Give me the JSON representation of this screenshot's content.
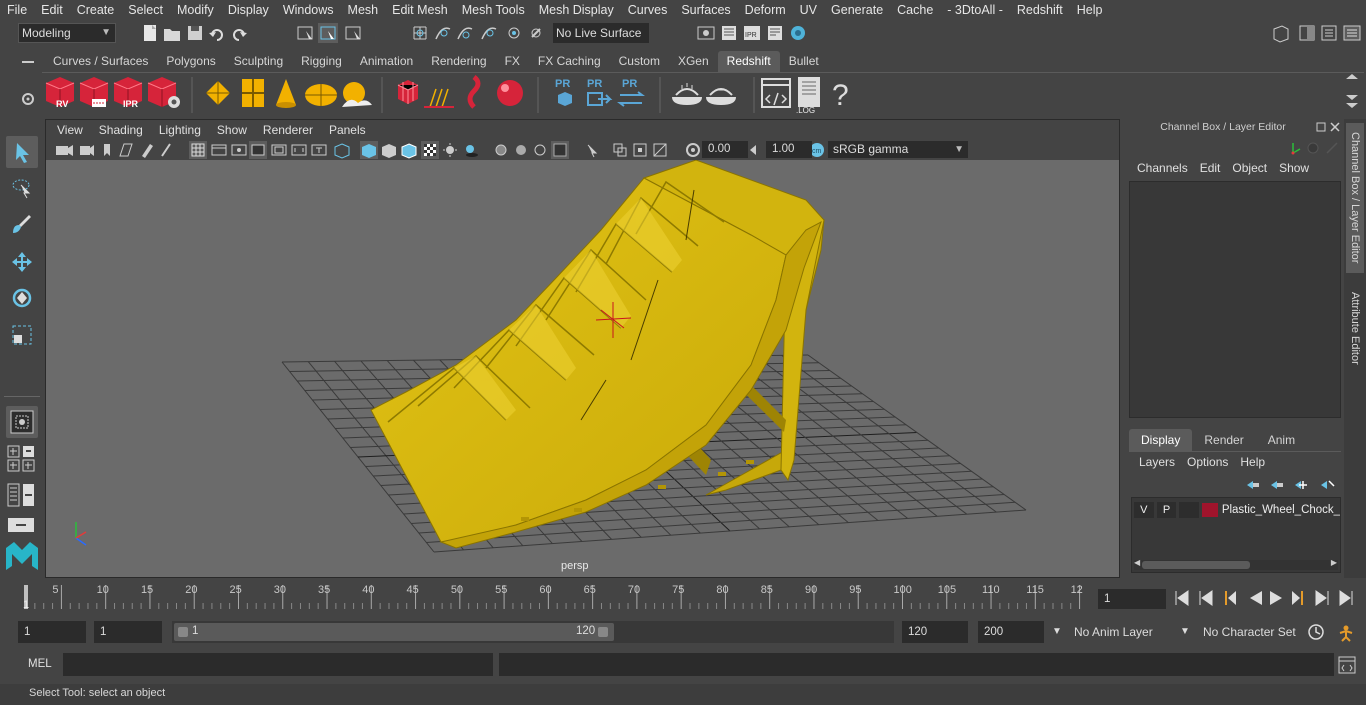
{
  "menubar": {
    "items": [
      "File",
      "Edit",
      "Create",
      "Select",
      "Modify",
      "Display",
      "Windows",
      "Mesh",
      "Edit Mesh",
      "Mesh Tools",
      "Mesh Display",
      "Curves",
      "Surfaces",
      "Deform",
      "UV",
      "Generate",
      "Cache",
      "- 3DtoAll -",
      "Redshift",
      "Help"
    ]
  },
  "statusline": {
    "mode": "Modeling",
    "live_surface": "No Live Surface"
  },
  "shelf": {
    "tabs": [
      "Curves / Surfaces",
      "Polygons",
      "Sculpting",
      "Rigging",
      "Animation",
      "Rendering",
      "FX",
      "FX Caching",
      "Custom",
      "XGen",
      "Redshift",
      "Bullet"
    ],
    "active_tab": "Redshift",
    "icon_labels": {
      "rv": "RV",
      "ipr": "IPR",
      "pr1": "PR",
      "pr2": "PR",
      "pr3": "PR",
      "log": ".LOG",
      "help": "?"
    }
  },
  "viewport": {
    "menu": [
      "View",
      "Shading",
      "Lighting",
      "Show",
      "Renderer",
      "Panels"
    ],
    "exposure": "0.00",
    "gamma": "1.00",
    "color_space": "sRGB gamma",
    "camera_label": "persp"
  },
  "channel_box": {
    "title": "Channel Box / Layer Editor",
    "menu": [
      "Channels",
      "Edit",
      "Object",
      "Show"
    ],
    "layer_tabs": [
      "Display",
      "Render",
      "Anim"
    ],
    "layer_menu": [
      "Layers",
      "Options",
      "Help"
    ],
    "layer": {
      "v": "V",
      "p": "P",
      "name": "Plastic_Wheel_Chock_Y"
    },
    "side_tabs": [
      "Channel Box / Layer Editor",
      "Attribute Editor"
    ]
  },
  "timeline": {
    "ticks": [
      "5",
      "10",
      "15",
      "20",
      "25",
      "30",
      "35",
      "40",
      "45",
      "50",
      "55",
      "60",
      "65",
      "70",
      "75",
      "80",
      "85",
      "90",
      "95",
      "100",
      "105",
      "110",
      "115",
      "12"
    ],
    "start_marker": "1",
    "current_frame": "1"
  },
  "range": {
    "start": "1",
    "playback_start": "1",
    "slider_start": "1",
    "slider_end": "120",
    "playback_end": "120",
    "end": "200",
    "anim_layer": "No Anim Layer",
    "character_set": "No Character Set"
  },
  "command": {
    "label": "MEL"
  },
  "help": {
    "text": "Select Tool: select an object"
  },
  "colors": {
    "model_yellow": "#d7b90b",
    "accent_blue": "#5aa6d6",
    "redshift_red": "#d6243a",
    "layer_color": "#a0142c"
  }
}
